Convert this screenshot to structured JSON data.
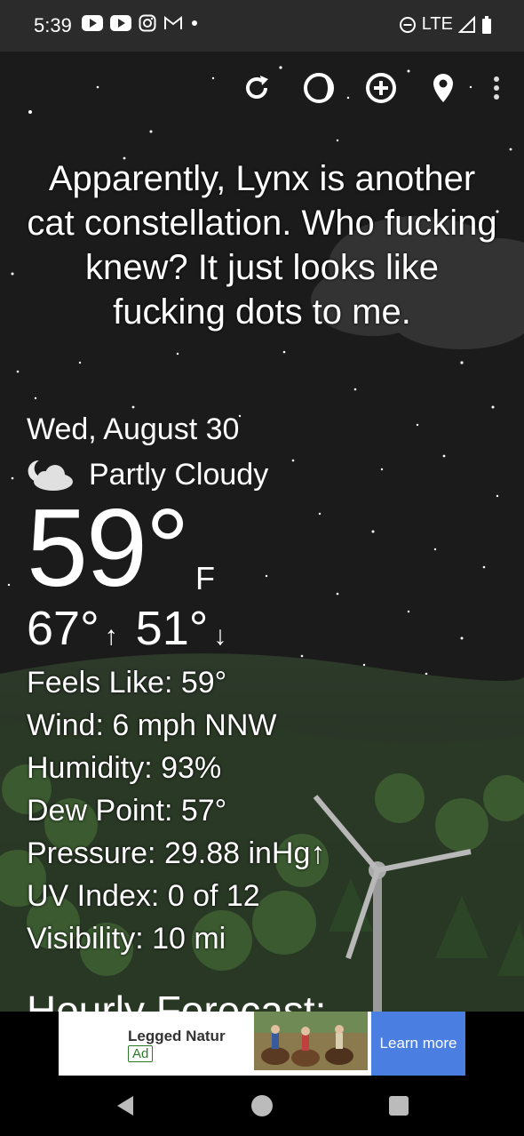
{
  "status_bar": {
    "time": "5:39",
    "network": "LTE"
  },
  "quote": "Apparently, Lynx is another cat constellation. Who fucking knew? It just looks like fucking dots to me.",
  "weather": {
    "date": "Wed, August 30",
    "condition": "Partly Cloudy",
    "condition_icon": "partly-cloudy-night-icon",
    "temperature": "59°",
    "unit": "F",
    "high": "67°",
    "high_arrow": "↑",
    "low": "51°",
    "low_arrow": "↓"
  },
  "details": [
    "Feels Like:  59°",
    "Wind:  6 mph NNW",
    "Humidity:  93%",
    "Dew Point:  57°",
    "Pressure:  29.88 inHg↑",
    "UV Index:  0 of 12",
    "Visibility:  10 mi"
  ],
  "hourly_heading": "Hourly Forecast:",
  "ad": {
    "title": "Legged Natur",
    "badge": "Ad",
    "cta": "Learn more"
  },
  "colors": {
    "sky": "#1b1b1b",
    "ad_button": "#4a7ee0",
    "status_bar": "#2b2b2b"
  }
}
